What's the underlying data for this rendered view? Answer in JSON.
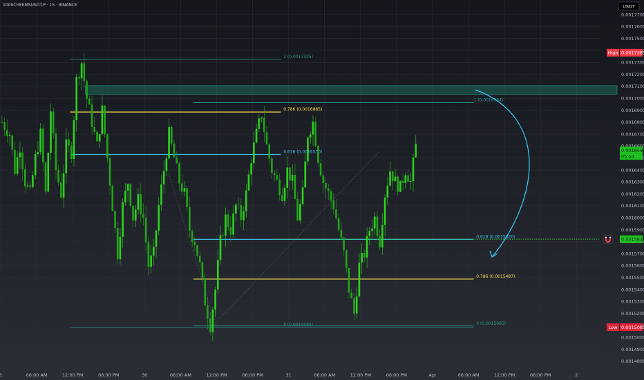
{
  "header": {
    "symbol_line": "1000CHEEMSUSDT.P · 15 · BINANCE",
    "currency": "USDT"
  },
  "colors": {
    "candle_up": "#2ed11f",
    "candle_down": "#23a418",
    "fib_teal": "#2a9d8f",
    "fib_cyan": "#39c4f0",
    "fib_yellow": "#f5e04a",
    "zone_fill": "#1e6b5c",
    "high_tag": "#f23645",
    "current_tag": "#20c020",
    "arrow": "#39c4f0"
  },
  "icons": [
    "magnet-icon"
  ],
  "chart_data": {
    "type": "candlestick",
    "y_axis": {
      "range": [
        0.001477,
        0.001777
      ],
      "tick_labels": [
        "0.0017700",
        "0.0017600",
        "0.0017500",
        "0.0017400",
        "0.0017300",
        "0.0017200",
        "0.0017100",
        "0.0017000",
        "0.0016900",
        "0.0016800",
        "0.0016700",
        "0.0016600",
        "0.0016500",
        "0.0016400",
        "0.0016300",
        "0.0016200",
        "0.0016100",
        "0.0016000",
        "0.0015900",
        "0.0015800",
        "0.0015700",
        "0.0015600",
        "0.0015500",
        "0.0015400",
        "0.0015300",
        "0.0015200",
        "0.0015100",
        "0.0015000",
        "0.0014900",
        "0.0014800"
      ],
      "tick_values": [
        0.00177,
        0.00176,
        0.00175,
        0.00174,
        0.00173,
        0.00172,
        0.00171,
        0.0017,
        0.00169,
        0.00168,
        0.00167,
        0.00166,
        0.00165,
        0.00164,
        0.00163,
        0.00162,
        0.00161,
        0.0016,
        0.00159,
        0.00158,
        0.00157,
        0.00156,
        0.00155,
        0.00154,
        0.00153,
        0.00152,
        0.00151,
        0.0015,
        0.00149,
        0.00148
      ]
    },
    "x_axis": {
      "tick_labels": [
        "6:",
        "06:00 AM",
        "12:00 PM",
        "06:00 PM",
        "30",
        "06:00 AM",
        "12:00 PM",
        "06:00 PM",
        "31",
        "06:00 AM",
        "12:00 PM",
        "06:00 PM",
        "Apr",
        "06:00 AM",
        "12:00 PM",
        "06:00 PM",
        "2"
      ],
      "tick_index": [
        0,
        14,
        28,
        42,
        56,
        70,
        84,
        98,
        112,
        126,
        140,
        154,
        168,
        182,
        196,
        210,
        224
      ]
    },
    "price_path": [
      [
        0,
        0.00168
      ],
      [
        3,
        0.00167
      ],
      [
        5,
        0.00164
      ],
      [
        7,
        0.00166
      ],
      [
        9,
        0.00163
      ],
      [
        11,
        0.00162
      ],
      [
        13,
        0.00165
      ],
      [
        15,
        0.00167
      ],
      [
        17,
        0.00162
      ],
      [
        19,
        0.00169
      ],
      [
        21,
        0.00164
      ],
      [
        23,
        0.00162
      ],
      [
        25,
        0.00166
      ],
      [
        27,
        0.001655
      ],
      [
        29,
        0.001715
      ],
      [
        31,
        0.00173
      ],
      [
        33,
        0.0017
      ],
      [
        35,
        0.00168
      ],
      [
        37,
        0.00166
      ],
      [
        39,
        0.00169
      ],
      [
        41,
        0.00165
      ],
      [
        43,
        0.00161
      ],
      [
        45,
        0.00157
      ],
      [
        47,
        0.00161
      ],
      [
        49,
        0.00163
      ],
      [
        51,
        0.0016
      ],
      [
        53,
        0.001615
      ],
      [
        55,
        0.0016
      ],
      [
        57,
        0.00156
      ],
      [
        59,
        0.00157
      ],
      [
        61,
        0.00161
      ],
      [
        63,
        0.00164
      ],
      [
        65,
        0.00167
      ],
      [
        67,
        0.00165
      ],
      [
        69,
        0.00163
      ],
      [
        71,
        0.00162
      ],
      [
        73,
        0.00159
      ],
      [
        75,
        0.00158
      ],
      [
        77,
        0.00156
      ],
      [
        79,
        0.00153
      ],
      [
        81,
        0.00151
      ],
      [
        83,
        0.00154
      ],
      [
        85,
        0.00158
      ],
      [
        87,
        0.0016
      ],
      [
        89,
        0.00159
      ],
      [
        91,
        0.00161
      ],
      [
        93,
        0.0016
      ],
      [
        95,
        0.00162
      ],
      [
        97,
        0.00165
      ],
      [
        99,
        0.00167
      ],
      [
        101,
        0.001687
      ],
      [
        103,
        0.00166
      ],
      [
        105,
        0.00164
      ],
      [
        107,
        0.00163
      ],
      [
        109,
        0.00162
      ],
      [
        111,
        0.00164
      ],
      [
        113,
        0.00163
      ],
      [
        115,
        0.0016
      ],
      [
        117,
        0.00162
      ],
      [
        119,
        0.00167
      ],
      [
        121,
        0.00168
      ],
      [
        123,
        0.00165
      ],
      [
        125,
        0.00163
      ],
      [
        127,
        0.00162
      ],
      [
        129,
        0.00161
      ],
      [
        131,
        0.00159
      ],
      [
        133,
        0.00157
      ],
      [
        135,
        0.00154
      ],
      [
        137,
        0.00152
      ],
      [
        139,
        0.00156
      ],
      [
        141,
        0.00157
      ],
      [
        143,
        0.00159
      ],
      [
        145,
        0.0016
      ],
      [
        147,
        0.00158
      ],
      [
        149,
        0.00162
      ],
      [
        151,
        0.00164
      ],
      [
        153,
        0.00163
      ],
      [
        155,
        0.001625
      ],
      [
        157,
        0.00164
      ],
      [
        159,
        0.00163
      ],
      [
        161,
        0.00166
      ]
    ],
    "price_range": {
      "high": 0.0017381,
      "low": 0.0015085
    },
    "fib_levels": [
      {
        "label": "1 (0.0017325)",
        "value": 0.0017325,
        "color": "teal"
      },
      {
        "label": "0.786 (0.0016885)",
        "value": 0.0016885,
        "color": "yellow"
      },
      {
        "label": "0.618 (0.0016530)",
        "value": 0.001653,
        "color": "cyan"
      },
      {
        "label": "0 (0.0015085)",
        "value": 0.0015085,
        "color": "teal"
      },
      {
        "label": "1 (0.0016964)",
        "value": 0.0016964,
        "color": "teal"
      },
      {
        "label": "0.618 (0.0015820)",
        "value": 0.001582,
        "color": "cyan"
      },
      {
        "label": "0.786 (0.0015487)",
        "value": 0.0015487,
        "color": "yellow"
      },
      {
        "label": "0 (0.0015095)",
        "value": 0.0015095,
        "color": "teal"
      }
    ],
    "zone": {
      "from": 0.001704,
      "to": 0.00171
    },
    "price_tags": [
      {
        "label": "High",
        "value": "0.0017381",
        "kind": "high"
      },
      {
        "label": "",
        "value": "0.0016563",
        "kind": "current",
        "countdown": "05:54"
      },
      {
        "label": "",
        "value": "0.0015821",
        "kind": "target"
      },
      {
        "label": "Low",
        "value": "0.0015085",
        "kind": "low"
      }
    ]
  }
}
